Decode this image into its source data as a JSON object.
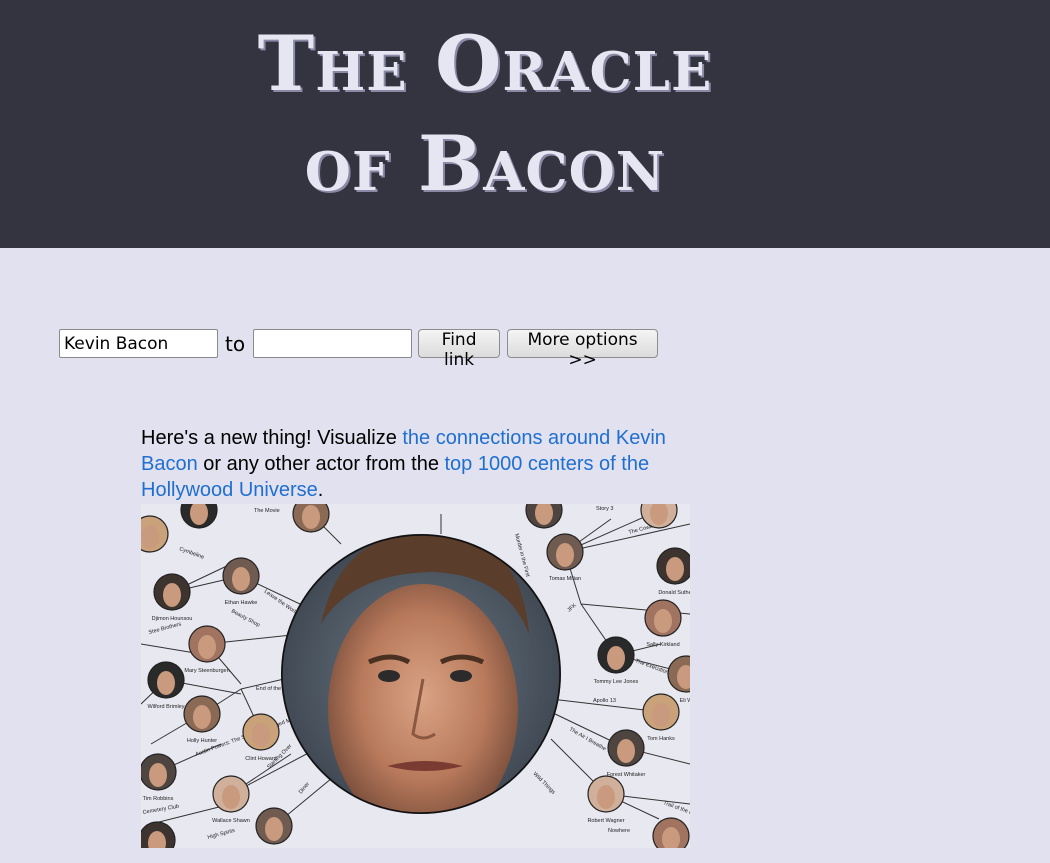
{
  "header": {
    "title_line1": "The Oracle",
    "title_line2": "of Bacon"
  },
  "search": {
    "from_value": "Kevin Bacon",
    "to_label": "to",
    "to_value": "",
    "find_button": "Find link",
    "more_button": "More options >>"
  },
  "promo": {
    "intro": "Here's a new thing! Visualize ",
    "link1": "the connections around Kevin Bacon",
    "mid": " or any other actor from the ",
    "link2": "top 1000 centers of the Hollywood Universe",
    "end": "."
  },
  "graph": {
    "actors": [
      {
        "name": "Ethan Hawke"
      },
      {
        "name": "Djimon Hounsou"
      },
      {
        "name": "Mary Steenburgen"
      },
      {
        "name": "Wilford Brimley"
      },
      {
        "name": "Holly Hunter"
      },
      {
        "name": "Clint Howard"
      },
      {
        "name": "Tim Robbins"
      },
      {
        "name": "Wallace Shawn"
      },
      {
        "name": "Tomas Milian"
      },
      {
        "name": "Donald Suthe"
      },
      {
        "name": "Sally Kirkland"
      },
      {
        "name": "Tommy Lee Jones"
      },
      {
        "name": "Eli W"
      },
      {
        "name": "Tom Hanks"
      },
      {
        "name": "Forest Whitaker"
      },
      {
        "name": "Robert Wagner"
      }
    ],
    "movies": [
      {
        "name": "The Movie"
      },
      {
        "name": "Cymbeline"
      },
      {
        "name": "Leave the World Behind"
      },
      {
        "name": "Beauty Shop"
      },
      {
        "name": "Stee Brothers"
      },
      {
        "name": "End of the Line"
      },
      {
        "name": "Austin Powers: The Spy Who Shagged Me"
      },
      {
        "name": "Starting Over"
      },
      {
        "name": "Diner"
      },
      {
        "name": "High Spirits"
      },
      {
        "name": "Cemetery Club"
      },
      {
        "name": "Story 3"
      },
      {
        "name": "The Cowboy Way"
      },
      {
        "name": "Murder in the First"
      },
      {
        "name": "JFK"
      },
      {
        "name": "The Executioner's Song"
      },
      {
        "name": "Apollo 13"
      },
      {
        "name": "The Air I Breathe"
      },
      {
        "name": "Wild Things"
      },
      {
        "name": "Trail of the Pink Panther"
      },
      {
        "name": "Nowhere"
      }
    ]
  },
  "colors": {
    "header_bg": "#33343f",
    "page_bg": "#e1e1ef",
    "link": "#1f6fd0",
    "logo_text": "#e6e6f3"
  }
}
